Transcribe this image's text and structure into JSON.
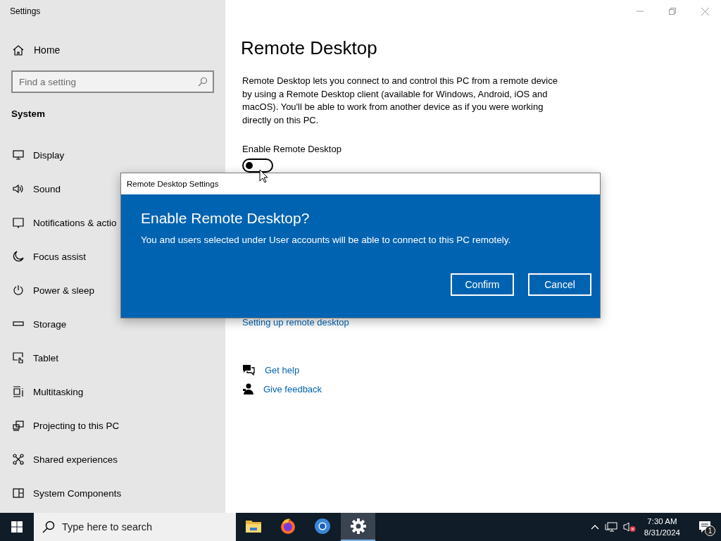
{
  "window": {
    "title": "Settings"
  },
  "sidebar": {
    "home": "Home",
    "search": {
      "placeholder": "Find a setting"
    },
    "section": "System",
    "items": [
      {
        "label": "Display"
      },
      {
        "label": "Sound"
      },
      {
        "label": "Notifications & actio"
      },
      {
        "label": "Focus assist"
      },
      {
        "label": "Power & sleep"
      },
      {
        "label": "Storage"
      },
      {
        "label": "Tablet"
      },
      {
        "label": "Multitasking"
      },
      {
        "label": "Projecting to this PC"
      },
      {
        "label": "Shared experiences"
      },
      {
        "label": "System Components"
      }
    ]
  },
  "page": {
    "title": "Remote Desktop",
    "description": "Remote Desktop lets you connect to and control this PC from a remote device by using a Remote Desktop client (available for Windows, Android, iOS and macOS). You'll be able to work from another device as if you were working directly on this PC.",
    "toggle": {
      "label": "Enable Remote Desktop",
      "on": false
    },
    "link": "Setting up remote desktop",
    "help": [
      {
        "label": "Get help"
      },
      {
        "label": "Give feedback"
      }
    ]
  },
  "dialog": {
    "title": "Remote Desktop Settings",
    "heading": "Enable Remote Desktop?",
    "message": "You and users selected under User accounts will be able to connect to this PC remotely.",
    "buttons": [
      {
        "label": "Confirm"
      },
      {
        "label": "Cancel"
      }
    ]
  },
  "taskbar": {
    "search": {
      "placeholder": "Type here to search"
    },
    "apps": [
      {
        "kind": "folder",
        "active": false
      },
      {
        "kind": "firefox",
        "active": false
      },
      {
        "kind": "chrome",
        "active": false
      },
      {
        "kind": "settings",
        "active": true
      }
    ],
    "time": "7:30 AM",
    "date": "8/31/2024",
    "notifications": "1"
  }
}
